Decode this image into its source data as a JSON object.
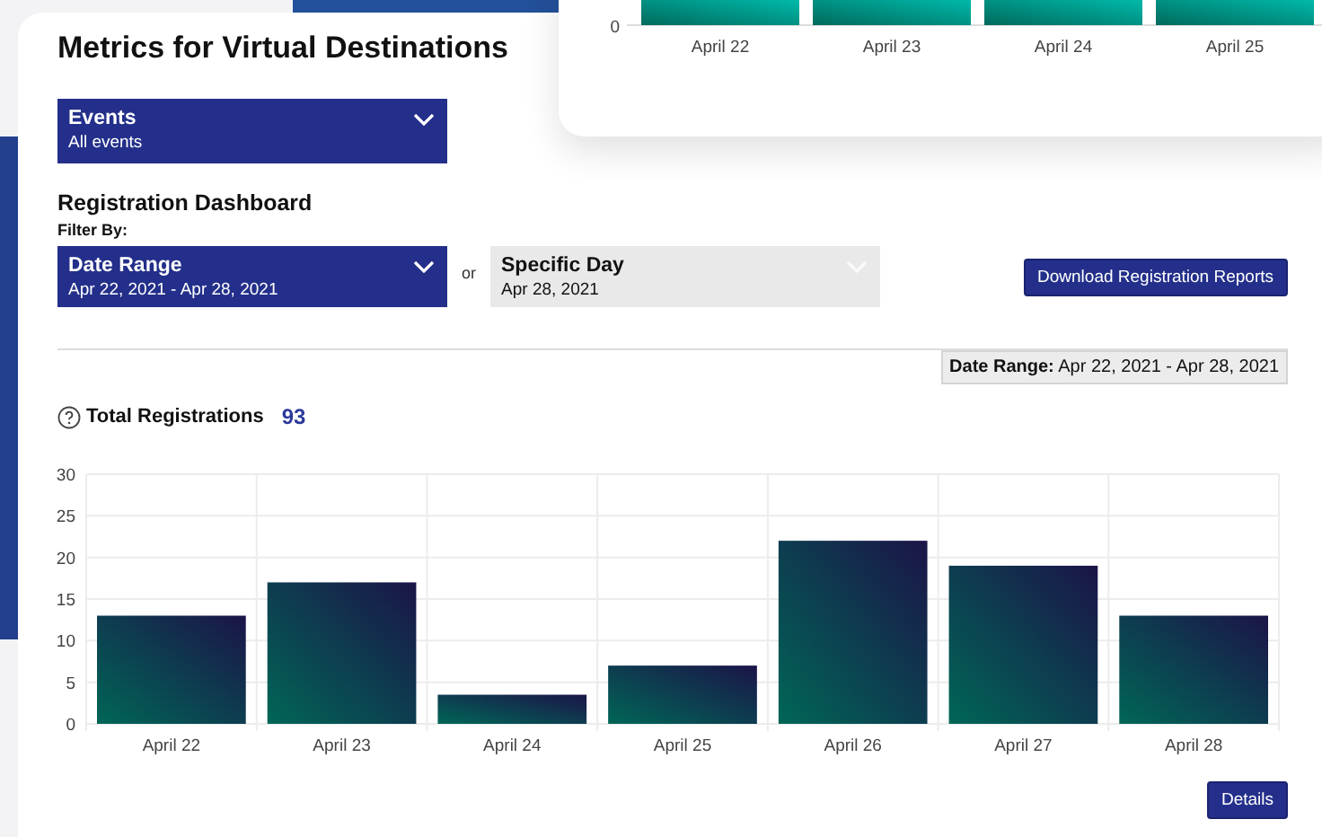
{
  "background_card": {
    "axis_label": "0",
    "bar_labels": [
      "April 22",
      "April 23",
      "April 24",
      "April 25"
    ]
  },
  "page_title": "Metrics for Virtual Destinations",
  "events_dropdown": {
    "label": "Events",
    "value": "All events"
  },
  "dashboard": {
    "title": "Registration Dashboard",
    "filter_label": "Filter By:",
    "filters": [
      {
        "label": "Date Range",
        "value": "Apr 22, 2021 - Apr 28, 2021",
        "selected": true
      },
      {
        "label": "Specific Day",
        "value": "Apr 28, 2021",
        "selected": false
      }
    ],
    "separator": "or",
    "download_button": "Download Registration Reports",
    "range_badge": {
      "label": "Date Range:",
      "value": "Apr 22, 2021 - Apr 28, 2021"
    },
    "total": {
      "label": "Total Registrations",
      "value": "93"
    },
    "chart_data": {
      "type": "bar",
      "categories": [
        "April 22",
        "April 23",
        "April 24",
        "April 25",
        "April 26",
        "April 27",
        "April 28"
      ],
      "values": [
        13,
        17,
        3.5,
        7,
        22,
        19,
        13
      ],
      "ylim": [
        0,
        30
      ],
      "grid": true,
      "yticks": [
        0,
        5,
        10,
        15,
        20,
        25,
        30
      ]
    },
    "details_button": "Details"
  }
}
